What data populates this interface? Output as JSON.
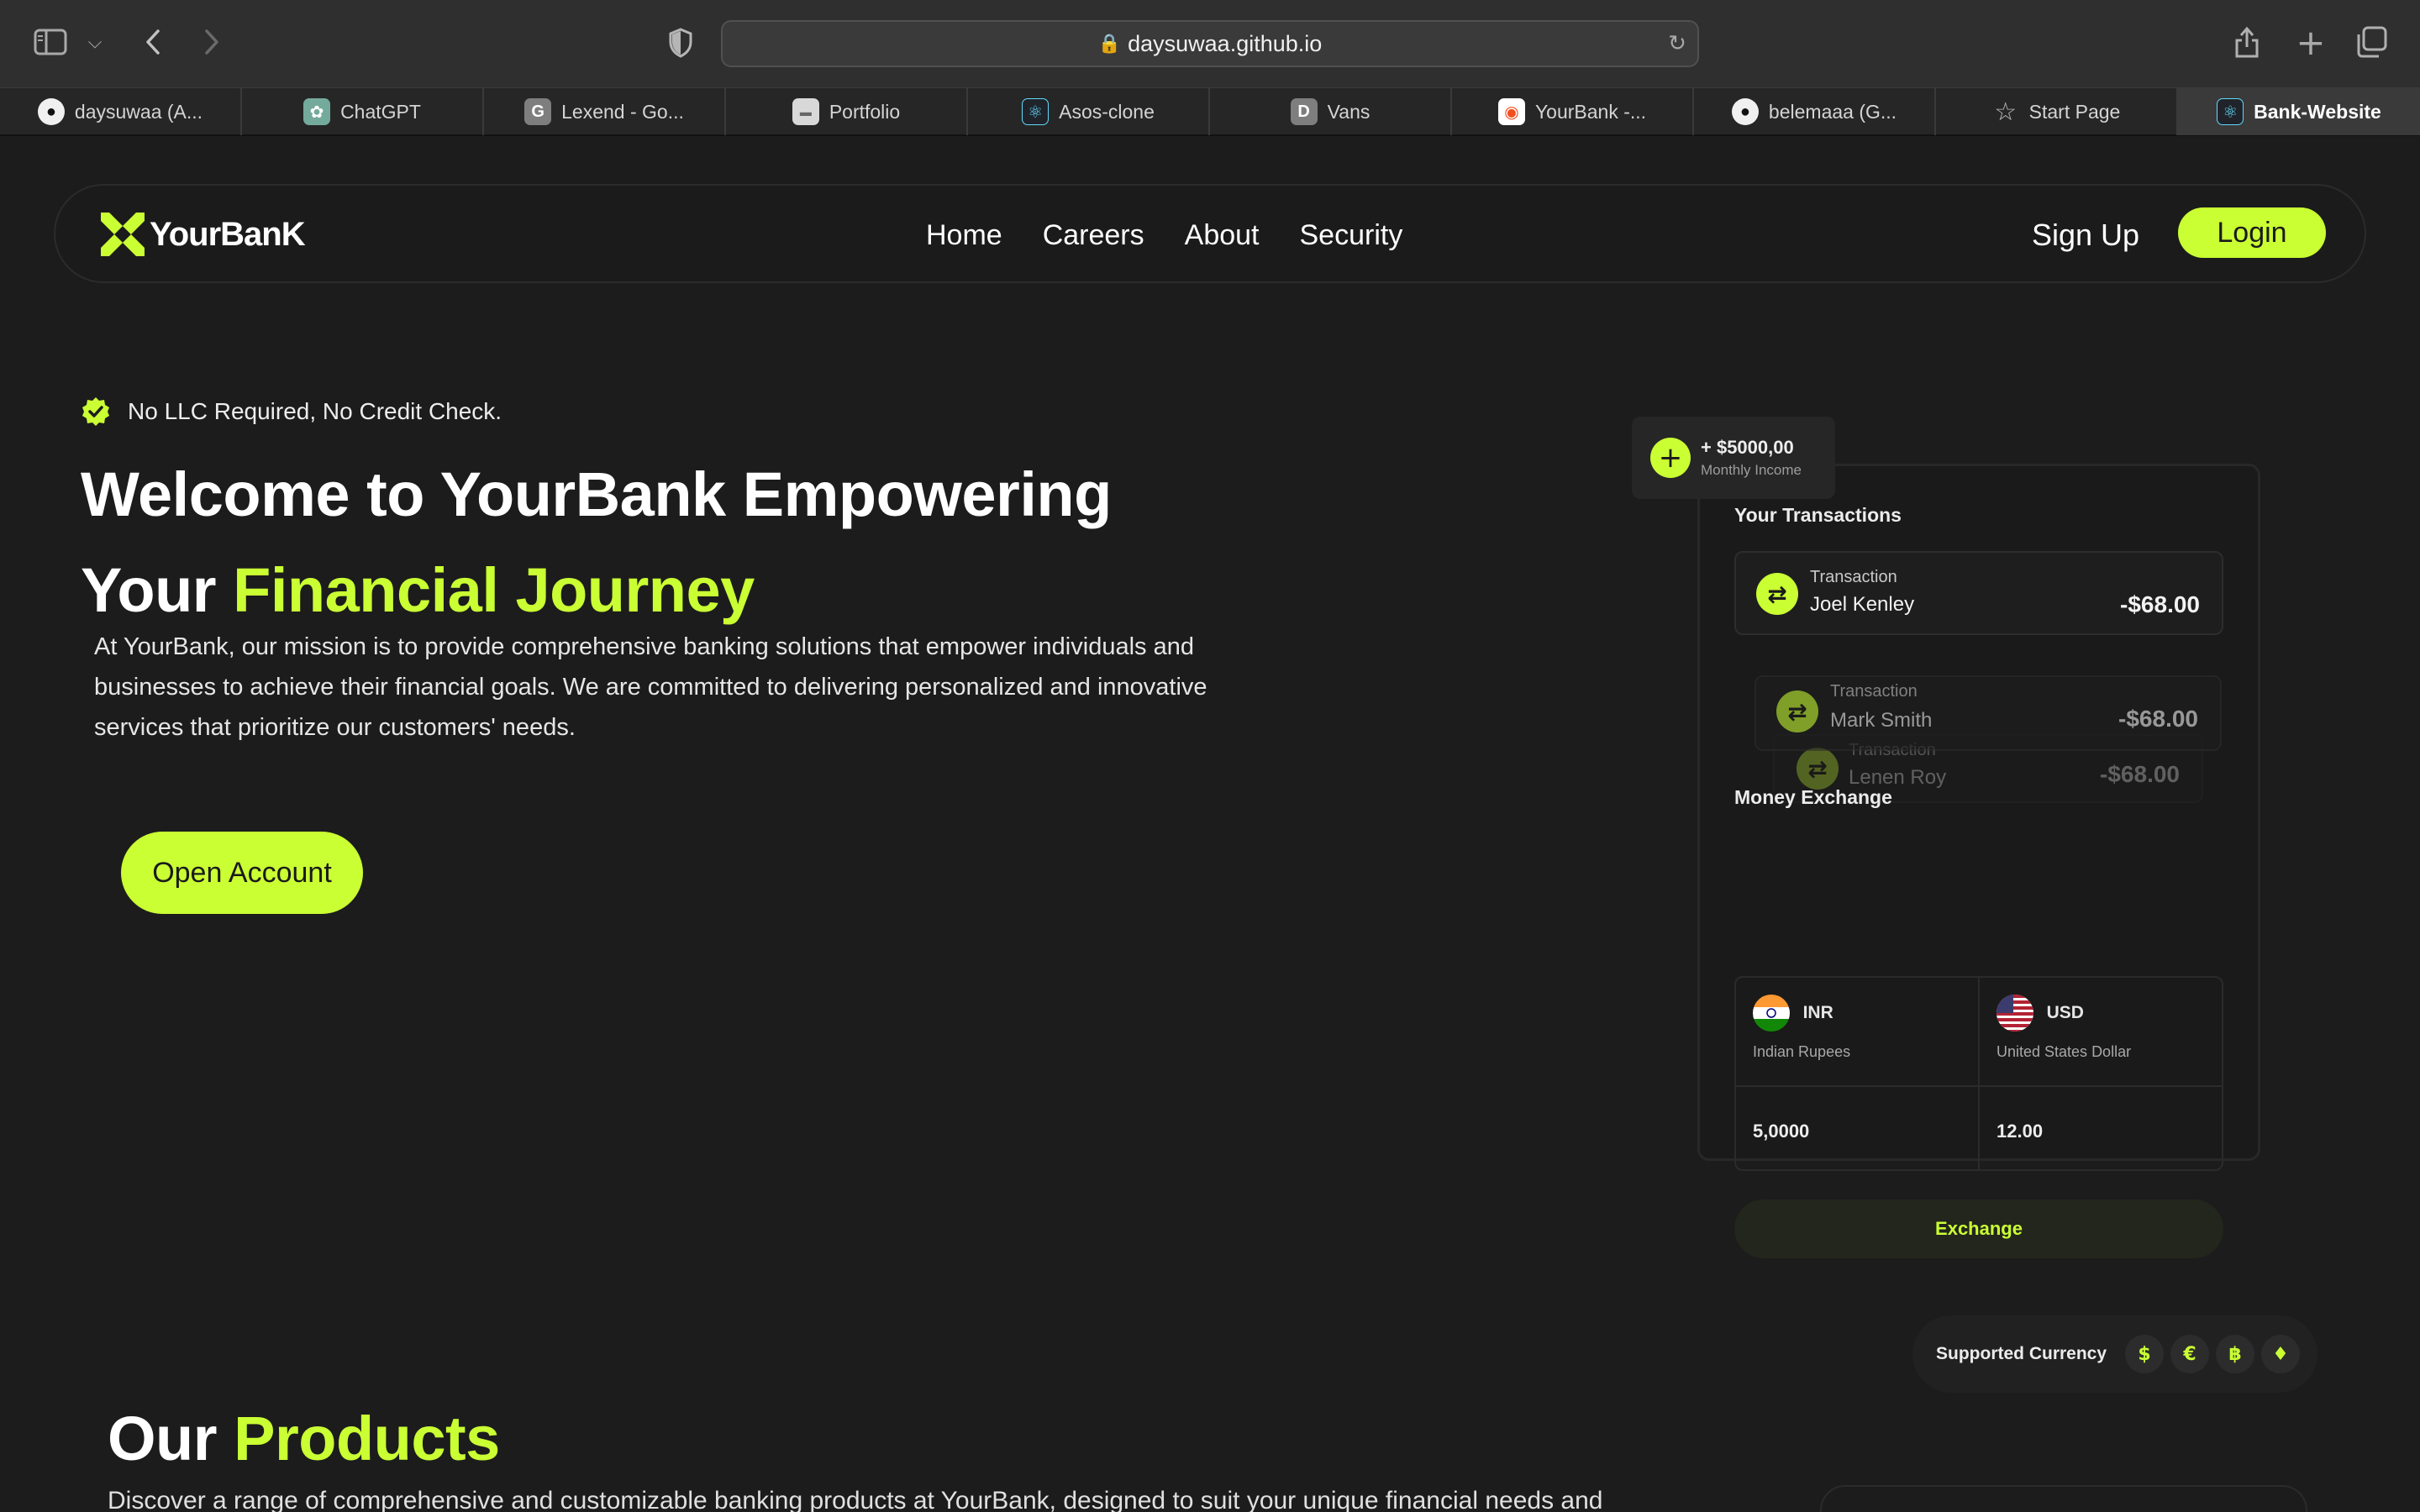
{
  "browser": {
    "url": "daysuwaa.github.io",
    "tabs": [
      {
        "label": "daysuwaa (A...",
        "icon": "github-icon"
      },
      {
        "label": "ChatGPT",
        "icon": "chatgpt-icon"
      },
      {
        "label": "Lexend - Go...",
        "icon": "google-fonts-icon"
      },
      {
        "label": "Portfolio",
        "icon": "portfolio-icon"
      },
      {
        "label": "Asos-clone",
        "icon": "react-icon"
      },
      {
        "label": "Vans",
        "icon": "vans-icon"
      },
      {
        "label": "YourBank -...",
        "icon": "figma-icon"
      },
      {
        "label": "belemaaa (G...",
        "icon": "github-icon"
      },
      {
        "label": "Start Page",
        "icon": "star-icon"
      },
      {
        "label": "Bank-Website",
        "icon": "react-icon"
      }
    ],
    "favicon_letters": {
      "google_fonts": "G",
      "vans": "D"
    }
  },
  "nav": {
    "logo": "YourBanK",
    "links": [
      "Home",
      "Careers",
      "About",
      "Security"
    ],
    "signup": "Sign Up",
    "login": "Login"
  },
  "hero": {
    "badge": "No LLC Required, No Credit Check.",
    "title_line1": "Welcome to YourBank Empowering",
    "title_line2_prefix": "Your ",
    "title_line2_highlight": "Financial Journey",
    "description": "At YourBank, our mission is to provide comprehensive banking solutions that empower individuals and businesses to achieve their financial goals. We are committed to delivering personalized and innovative services that prioritize our customers' needs.",
    "cta": "Open Account"
  },
  "dashboard": {
    "income_amount": "+ $5000,00",
    "income_label": "Monthly Income",
    "transactions_title": "Your Transactions",
    "transactions": [
      {
        "label": "Transaction",
        "name": "Joel Kenley",
        "amount": "-$68.00"
      },
      {
        "label": "Transaction",
        "name": "Mark Smith",
        "amount": "-$68.00"
      },
      {
        "label": "Transaction",
        "name": "Lenen Roy",
        "amount": "-$68.00"
      }
    ],
    "exchange_title": "Money Exchange",
    "from_currency": {
      "code": "INR",
      "name": "Indian Rupees",
      "value": "5,0000"
    },
    "to_currency": {
      "code": "USD",
      "name": "United States Dollar",
      "value": "12.00"
    },
    "exchange_button": "Exchange",
    "supported_label": "Supported Currency",
    "coins": [
      "$",
      "€",
      "฿",
      "♦"
    ]
  },
  "products": {
    "title_prefix": "Our ",
    "title_highlight": "Products",
    "description": "Discover a range of comprehensive and customizable banking products at YourBank, designed to suit your unique financial needs and"
  },
  "colors": {
    "accent": "#caff33",
    "background": "#1c1c1c"
  }
}
